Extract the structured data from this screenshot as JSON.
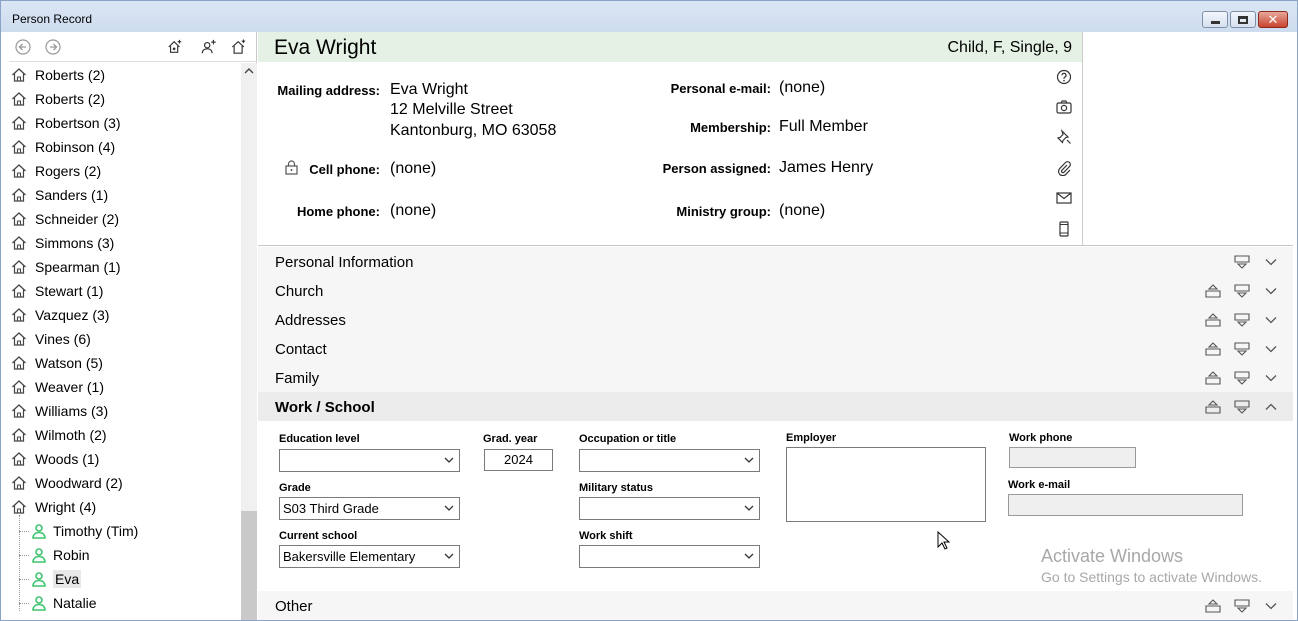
{
  "window": {
    "title": "Person Record"
  },
  "tree": {
    "families": [
      "Roberts (2)",
      "Roberts (2)",
      "Robertson (3)",
      "Robinson (4)",
      "Rogers (2)",
      "Sanders (1)",
      "Schneider (2)",
      "Simmons (3)",
      "Spearman (1)",
      "Stewart (1)",
      "Vazquez (3)",
      "Vines (6)",
      "Watson (5)",
      "Weaver (1)",
      "Williams (3)",
      "Wilmoth (2)",
      "Woods (1)",
      "Woodward (2)",
      "Wright (4)"
    ],
    "members": [
      "Timothy (Tim)",
      "Robin",
      "Eva",
      "Natalie"
    ],
    "selected": "Eva"
  },
  "header": {
    "name": "Eva Wright",
    "summary": "Child, F, Single, 9"
  },
  "info": {
    "mailing_label": "Mailing address:",
    "mailing_lines": [
      "Eva Wright",
      "12 Melville Street",
      "Kantonburg, MO 63058"
    ],
    "cell_label": "Cell phone:",
    "cell_value": "(none)",
    "home_label": "Home phone:",
    "home_value": "(none)",
    "email_label": "Personal e-mail:",
    "email_value": "(none)",
    "membership_label": "Membership:",
    "membership_value": "Full Member",
    "assigned_label": "Person assigned:",
    "assigned_value": "James Henry",
    "ministry_label": "Ministry group:",
    "ministry_value": "(none)"
  },
  "sections": [
    "Personal Information",
    "Church",
    "Addresses",
    "Contact",
    "Family",
    "Work / School",
    "Other"
  ],
  "form": {
    "education_level_label": "Education level",
    "education_level_value": "",
    "grad_year_label": "Grad. year",
    "grad_year_value": "2024",
    "occupation_label": "Occupation or title",
    "occupation_value": "",
    "employer_label": "Employer",
    "employer_value": "",
    "work_phone_label": "Work phone",
    "work_phone_value": "",
    "grade_label": "Grade",
    "grade_value": "S03 Third Grade",
    "military_label": "Military status",
    "military_value": "",
    "work_email_label": "Work e-mail",
    "work_email_value": "",
    "school_label": "Current school",
    "school_value": "Bakersville Elementary",
    "shift_label": "Work shift",
    "shift_value": ""
  },
  "watermark": {
    "line1": "Activate Windows",
    "line2": "Go to Settings to activate Windows."
  },
  "colors": {
    "header_bg": "#e5f1e4",
    "person_icon": "#3cc46e"
  }
}
